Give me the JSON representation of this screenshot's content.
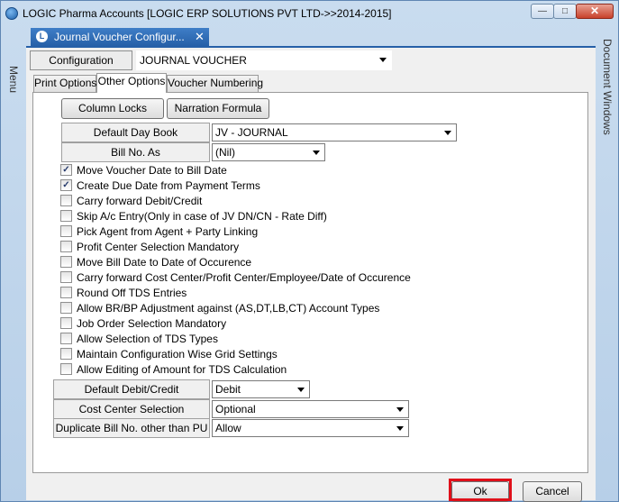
{
  "window": {
    "title": "LOGIC Pharma Accounts  [LOGIC ERP SOLUTIONS PVT LTD->>2014-2015]",
    "minimize_glyph": "—",
    "maximize_glyph": "□",
    "close_glyph": "✕"
  },
  "side": {
    "menu_label": "Menu",
    "document_windows_label": "Document Windows"
  },
  "doc_tab": {
    "icon_letter": "L",
    "title": "Journal Voucher Configur...",
    "close_glyph": "✕"
  },
  "configuration": {
    "button_label": "Configuration",
    "value": "JOURNAL VOUCHER"
  },
  "tabs": [
    {
      "label": "Print Options",
      "active": false
    },
    {
      "label": "Other Options",
      "active": true
    },
    {
      "label": "Voucher Numbering",
      "active": false
    }
  ],
  "buttons": {
    "column_locks": "Column Locks",
    "narration_formula": "Narration Formula"
  },
  "fields": {
    "default_day_book": {
      "label": "Default Day Book",
      "value": "JV - JOURNAL"
    },
    "bill_no_as": {
      "label": "Bill No. As",
      "value": "(Nil)"
    },
    "default_debit_credit": {
      "label": "Default Debit/Credit",
      "value": "Debit"
    },
    "cost_center_selection": {
      "label": "Cost Center Selection",
      "value": "Optional"
    },
    "duplicate_bill_no": {
      "label": "Duplicate Bill No. other than PU",
      "value": "Allow"
    }
  },
  "checkboxes": [
    {
      "label": "Move Voucher Date to Bill Date",
      "checked": true
    },
    {
      "label": "Create Due Date from Payment Terms",
      "checked": true
    },
    {
      "label": "Carry forward Debit/Credit",
      "checked": false
    },
    {
      "label": "Skip A/c Entry(Only in case of JV DN/CN - Rate Diff)",
      "checked": false
    },
    {
      "label": "Pick Agent from Agent + Party Linking",
      "checked": false
    },
    {
      "label": "Profit Center Selection Mandatory",
      "checked": false
    },
    {
      "label": "Move Bill Date to Date of Occurence",
      "checked": false
    },
    {
      "label": "Carry forward Cost Center/Profit Center/Employee/Date of Occurence",
      "checked": false
    },
    {
      "label": "Round Off TDS Entries",
      "checked": false
    },
    {
      "label": "Allow BR/BP Adjustment against (AS,DT,LB,CT) Account Types",
      "checked": false
    },
    {
      "label": "Job Order Selection Mandatory",
      "checked": false
    },
    {
      "label": "Allow Selection of TDS Types",
      "checked": false
    },
    {
      "label": "Maintain Configuration Wise Grid Settings",
      "checked": false
    },
    {
      "label": "Allow Editing of Amount for TDS Calculation",
      "checked": false
    }
  ],
  "footer": {
    "ok_label": "Ok",
    "cancel_label": "Cancel"
  },
  "check_glyph": "✓",
  "colors": {
    "highlight": "#e0101a",
    "tab_active_bg": "#2660a8"
  }
}
